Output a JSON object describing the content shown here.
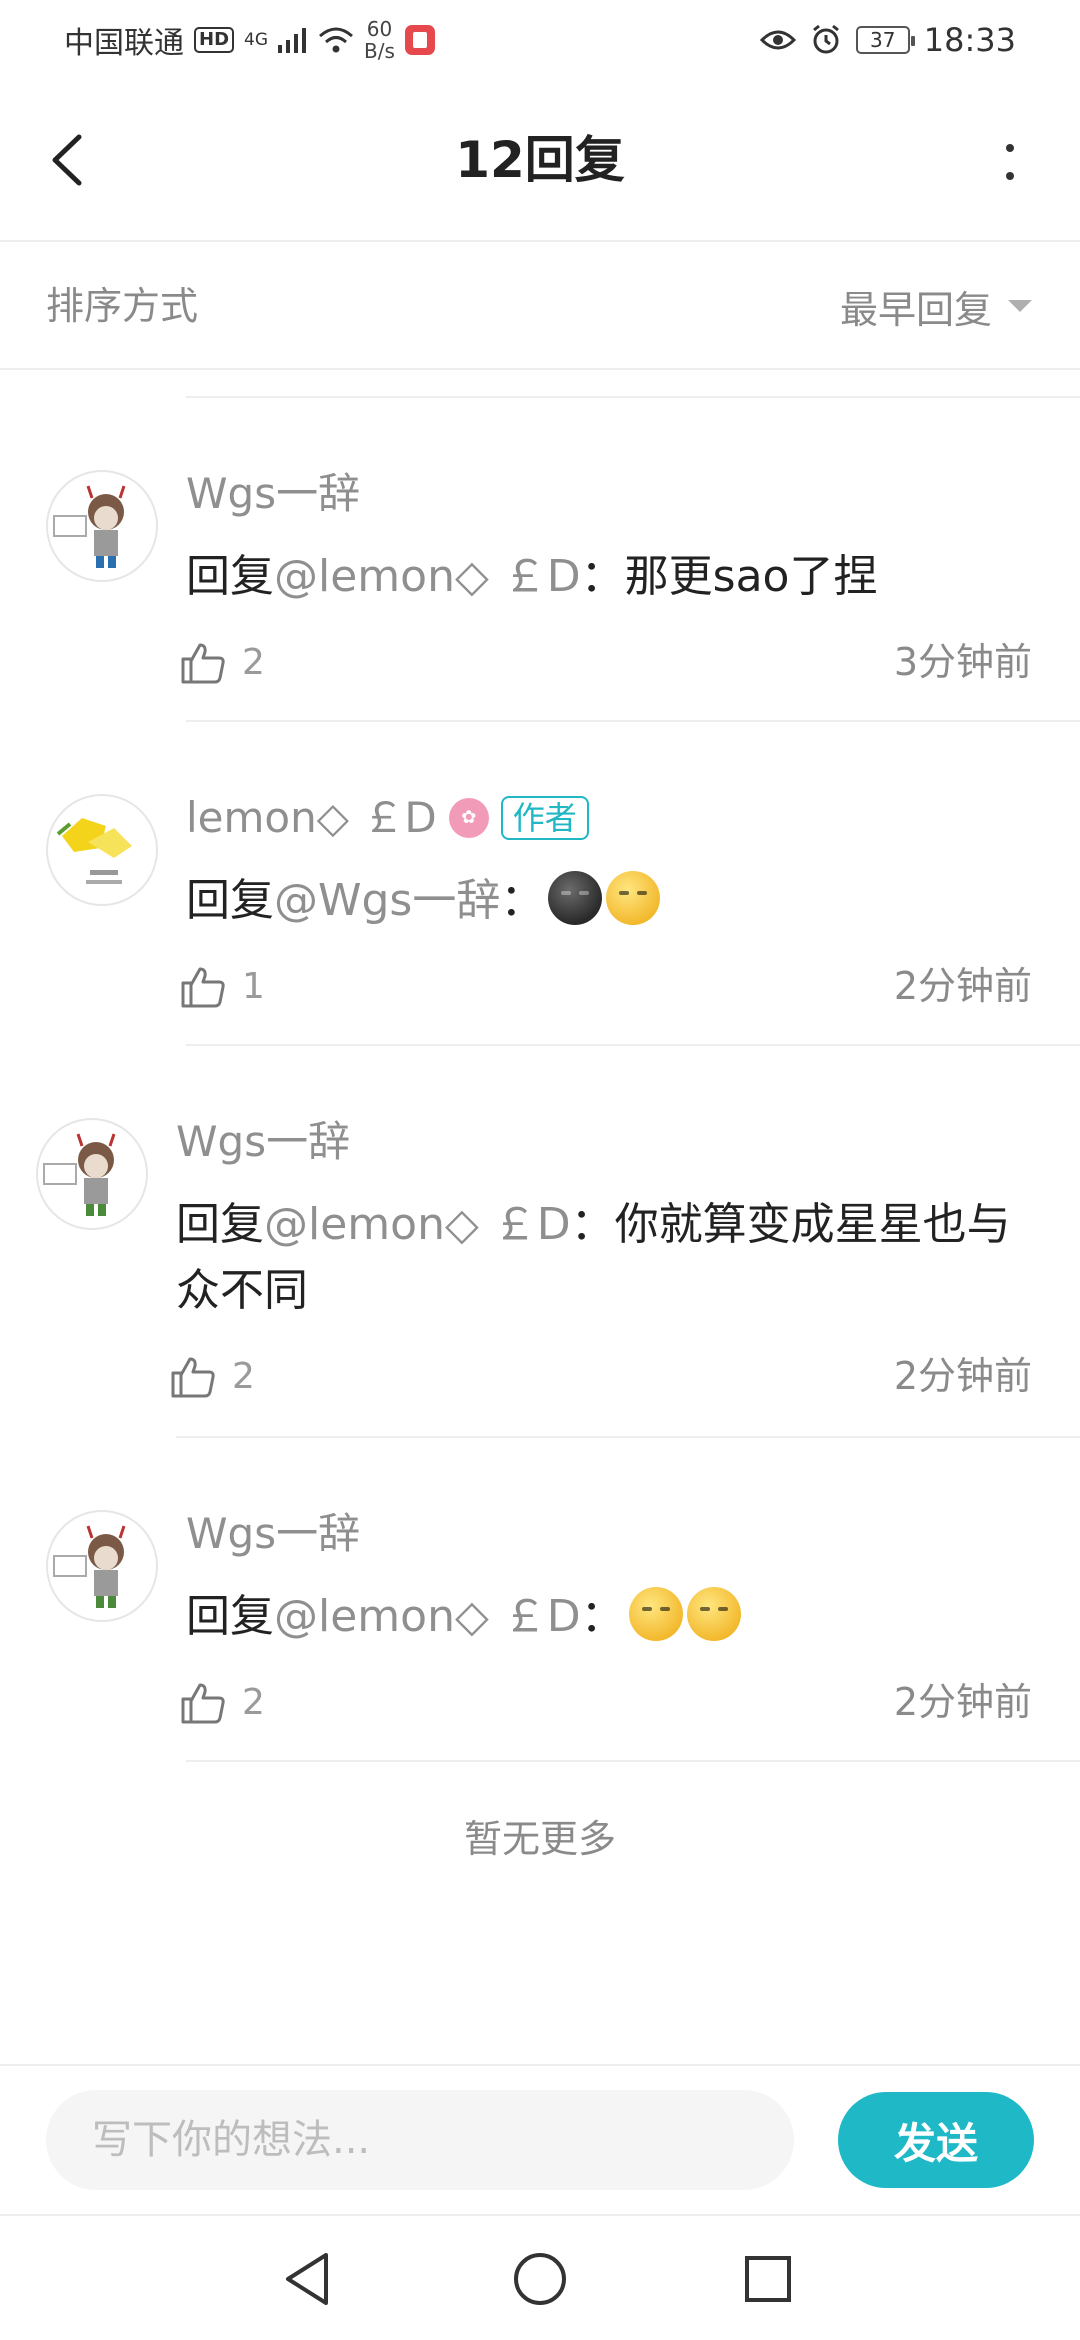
{
  "status_bar": {
    "carrier": "中国联通",
    "hd": "HD",
    "network": "4G",
    "speed_value": "60",
    "speed_unit": "B/s",
    "battery": "37",
    "time": "18:33"
  },
  "header": {
    "title": "12回复"
  },
  "sort": {
    "label": "排序方式",
    "value": "最早回复"
  },
  "replies": [
    {
      "username": "Wgs一辞",
      "prefix": "回复",
      "mention": "@lemon◇ ￡D",
      "text": "：那更sao了捏",
      "likes": "2",
      "time": "3分钟前"
    },
    {
      "username": "lemon◇ ￡D",
      "badge": "作者",
      "prefix": "回复",
      "mention": "@Wgs一辞",
      "text": "：",
      "likes": "1",
      "time": "2分钟前"
    },
    {
      "username": "Wgs一辞",
      "prefix": "回复",
      "mention": "@lemon◇ ￡D",
      "text": "：你就算变成星星也与众不同",
      "likes": "2",
      "time": "2分钟前"
    },
    {
      "username": "Wgs一辞",
      "prefix": "回复",
      "mention": "@lemon◇ ￡D",
      "text": "：",
      "likes": "2",
      "time": "2分钟前"
    }
  ],
  "footer_text": "暂无更多",
  "composer": {
    "placeholder": "写下你的想法...",
    "send_label": "发送"
  },
  "colors": {
    "accent": "#1fb8c6",
    "muted": "#8a8a8a"
  },
  "icons": [
    "back-icon",
    "more-icon",
    "dropdown-icon",
    "thumb-up-icon",
    "nav-back-icon",
    "nav-home-icon",
    "nav-recents-icon"
  ]
}
